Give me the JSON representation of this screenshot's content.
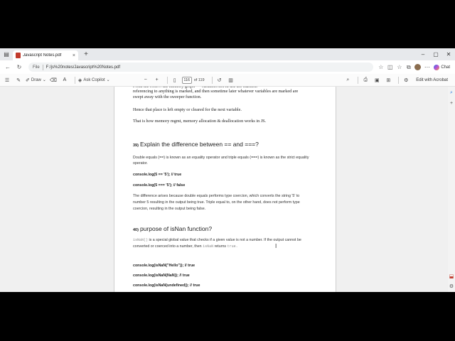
{
  "tabs": [
    {
      "label": "Javascript Notes.pdf",
      "close": "×"
    }
  ],
  "browser": {
    "new_tab": "+",
    "minimize": "–",
    "maximize": "▢",
    "close": "✕",
    "back": "←",
    "refresh": "↻",
    "scheme": "File",
    "url": "F:/js%20notes/Javascript%20Notes.pdf",
    "chat_label": "Chat"
  },
  "pdf_toolbar": {
    "contents_icon": "☰",
    "draw_label": "Draw",
    "ask_copilot_label": "Ask Copilot",
    "zoom_out": "−",
    "zoom_in": "+",
    "current_page": "116",
    "page_count": "of 119",
    "edit_acrobat": "Edit with Acrobat"
  },
  "document": {
    "top_partial": "referencing to anything is marked, and then sometime later whatever variables are marked are",
    "top_line2": "swept away with the sweeper function.",
    "para1": "Hence that place is left empty or cleared for the next variable.",
    "para2": "That is how memory mgmt, memory allocation & deallocation works in JS.",
    "q39_num": "39)",
    "q39_title": "Explain the difference between == and ===?",
    "q39_p1": "Double equals (==) is known as an equality operator and triple equals (===) is known as the strict equality operator.",
    "code1": "console.log(5 == '5'); // true",
    "code2": "console.log(5 === '5'); // false",
    "q39_p2_a": "The difference arises because double equals performs type coercion, which converts the string '5' to",
    "q39_p2_b": "number 5 resulting in the output being true. Triple equal to, on the other hand, does not perform type",
    "q39_p2_c": "coercion, resulting in the output being false.",
    "q40_num": "40)",
    "q40_title": "purpose of isNan function?",
    "q40_code_isnan": "isNaN()",
    "q40_p1_a": "is a special global value that checks if a given value is not a number. If the output cannot be",
    "q40_p1_b": "converted or coerced into a number, then",
    "q40_code_isnan2": "isNaN",
    "q40_p1_c": "returns",
    "q40_code_true": "true.",
    "code3": "console.log(isNaN(\"Hello\")); // true",
    "code4": "console.log(isNaN(NaN)); // true",
    "code5": "console.log(isNaN(undefined)); // true"
  },
  "colors": {
    "accent": "#c0392b",
    "page_bg": "#ffffff",
    "viewer_bg": "#f0f0f0"
  }
}
